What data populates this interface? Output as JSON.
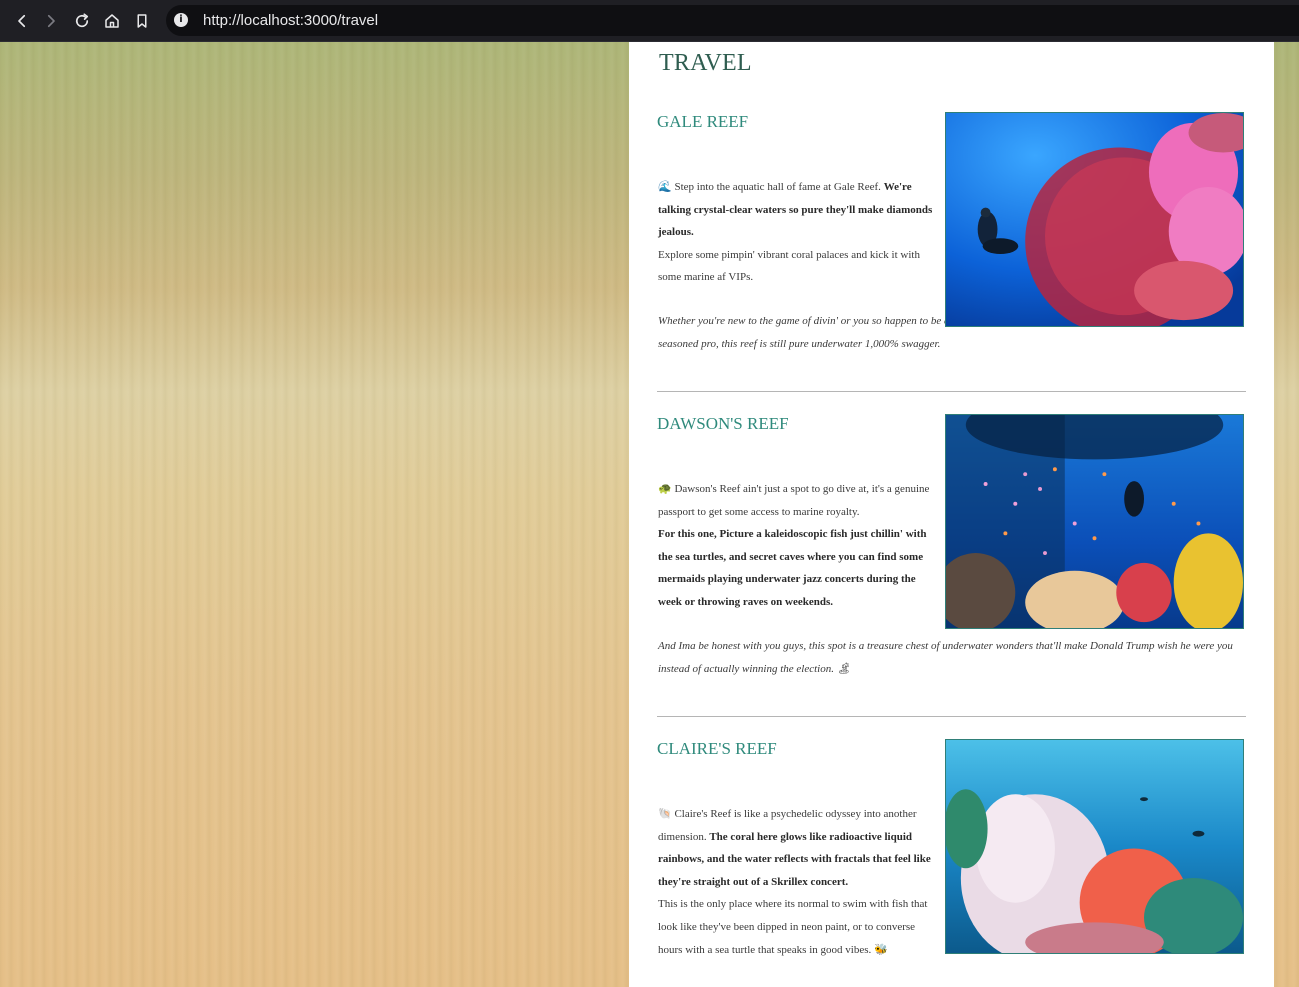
{
  "browser": {
    "url": "http://localhost:3000/travel"
  },
  "page": {
    "title": "TRAVEL"
  },
  "reefs": [
    {
      "title": "GALE REEF",
      "emoji": "🌊",
      "intro": " Step into the aquatic hall of fame at Gale Reef. ",
      "bold": "We're talking crystal-clear waters so pure they'll make diamonds jealous.",
      "text": "Explore some pimpin' vibrant coral palaces and kick it with some marine af VIPs.",
      "italic": "Whether you're new to the game of divin' or you so happen to be a seasoned pro, this reef is still pure underwater 1,000% swagger."
    },
    {
      "title": "DAWSON'S REEF",
      "emoji": "🐢",
      "intro": " Dawson's Reef ain't just a spot to go dive at, it's a genuine passport to get some access to marine royalty.",
      "bold": "For this one, Picture a kaleidoscopic fish just chillin' with the sea turtles, and secret caves where you can find some mermaids playing underwater jazz concerts during the week or throwing raves on weekends.",
      "italic": "And Ima be honest with you guys, this spot is a treasure chest of underwater wonders that'll make Donald Trump wish he were you instead of actually winning the election.",
      "end_emoji": "🏝"
    },
    {
      "title": "CLAIRE'S REEF",
      "emoji": "🐚",
      "intro": " Claire's Reef is like a psychedelic odyssey into another dimension. ",
      "bold": "The coral here glows like radioactive liquid rainbows, and the water reflects with fractals that feel like they're straight out of a Skrillex concert.",
      "text": "This is the only place where its normal to swim with fish that look like they've been dipped in neon paint, or to converse hours with a sea turtle that speaks in good vibes.",
      "end_emoji": "🐝"
    }
  ],
  "colors": {
    "title": "#2f5d50",
    "reef_title": "#2f8a7c",
    "chrome": "#1f1f24"
  }
}
